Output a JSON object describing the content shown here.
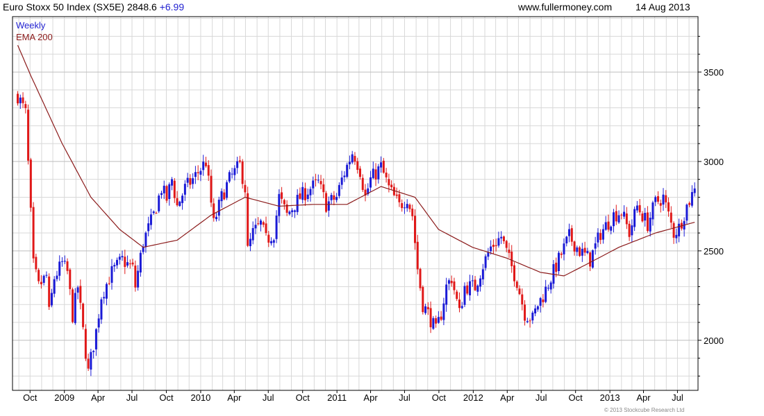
{
  "header": {
    "title": "Euro Stoxx 50 Index (SX5E) 2848.6",
    "change": "+6.99",
    "website": "www.fullermoney.com",
    "date": "14 Aug 2013"
  },
  "copyright": "© 2013 Stockcube Research Ltd",
  "colors": {
    "up": "#1a1ad6",
    "down": "#e01818",
    "ema": "#8b1a1a",
    "grid": "#d8d8d8",
    "legend_weekly": "#1f1fd0",
    "legend_ema": "#8b1a1a"
  },
  "chart_data": {
    "type": "candlestick",
    "legend": [
      "Weekly",
      "EMA 200"
    ],
    "legend_placement": "top-left",
    "y_axis_position": "right",
    "ylim": [
      1720,
      3810
    ],
    "yticks": [
      2000,
      2500,
      3000,
      3500
    ],
    "grid": true,
    "x_tick_labels": [
      "Oct",
      "2009",
      "Apr",
      "Jul",
      "Oct",
      "2010",
      "Apr",
      "Jul",
      "Oct",
      "2011",
      "Apr",
      "Jul",
      "Oct",
      "2012",
      "Apr",
      "Jul",
      "Oct",
      "2013",
      "Apr",
      "Jul"
    ],
    "weekly_close_path": [
      [
        "2008-08-29",
        3370
      ],
      [
        "2008-09-19",
        3270
      ],
      [
        "2008-10-10",
        2420
      ],
      [
        "2008-10-24",
        2300
      ],
      [
        "2008-11-14",
        2360
      ],
      [
        "2008-11-21",
        2150
      ],
      [
        "2008-12-05",
        2350
      ],
      [
        "2008-12-26",
        2430
      ],
      [
        "2009-01-09",
        2380
      ],
      [
        "2009-01-23",
        2140
      ],
      [
        "2009-02-06",
        2300
      ],
      [
        "2009-02-20",
        2050
      ],
      [
        "2009-03-06",
        1820
      ],
      [
        "2009-03-13",
        1900
      ],
      [
        "2009-03-27",
        2050
      ],
      [
        "2009-04-10",
        2250
      ],
      [
        "2009-05-08",
        2380
      ],
      [
        "2009-06-05",
        2450
      ],
      [
        "2009-07-03",
        2400
      ],
      [
        "2009-07-10",
        2300
      ],
      [
        "2009-07-31",
        2550
      ],
      [
        "2009-08-28",
        2700
      ],
      [
        "2009-09-18",
        2850
      ],
      [
        "2009-10-02",
        2790
      ],
      [
        "2009-10-16",
        2900
      ],
      [
        "2009-10-30",
        2750
      ],
      [
        "2009-11-20",
        2850
      ],
      [
        "2009-12-11",
        2900
      ],
      [
        "2010-01-01",
        2960
      ],
      [
        "2010-01-15",
        3000
      ],
      [
        "2010-02-05",
        2650
      ],
      [
        "2010-02-26",
        2800
      ],
      [
        "2010-03-19",
        2900
      ],
      [
        "2010-04-16",
        2980
      ],
      [
        "2010-04-30",
        2850
      ],
      [
        "2010-05-07",
        2500
      ],
      [
        "2010-05-21",
        2600
      ],
      [
        "2010-06-11",
        2650
      ],
      [
        "2010-06-25",
        2560
      ],
      [
        "2010-07-16",
        2600
      ],
      [
        "2010-07-30",
        2800
      ],
      [
        "2010-08-20",
        2700
      ],
      [
        "2010-09-10",
        2760
      ],
      [
        "2010-09-24",
        2800
      ],
      [
        "2010-10-22",
        2850
      ],
      [
        "2010-11-12",
        2880
      ],
      [
        "2010-12-03",
        2760
      ],
      [
        "2010-12-31",
        2800
      ],
      [
        "2011-01-14",
        2900
      ],
      [
        "2011-02-11",
        3050
      ],
      [
        "2011-02-18",
        3030
      ],
      [
        "2011-03-04",
        2950
      ],
      [
        "2011-03-18",
        2800
      ],
      [
        "2011-04-01",
        2900
      ],
      [
        "2011-04-29",
        2970
      ],
      [
        "2011-05-20",
        2850
      ],
      [
        "2011-06-17",
        2750
      ],
      [
        "2011-07-08",
        2800
      ],
      [
        "2011-07-22",
        2700
      ],
      [
        "2011-08-05",
        2400
      ],
      [
        "2011-08-19",
        2200
      ],
      [
        "2011-09-02",
        2150
      ],
      [
        "2011-09-23",
        2050
      ],
      [
        "2011-10-07",
        2150
      ],
      [
        "2011-10-21",
        2300
      ],
      [
        "2011-11-04",
        2350
      ],
      [
        "2011-11-25",
        2150
      ],
      [
        "2011-12-09",
        2300
      ],
      [
        "2012-01-06",
        2300
      ],
      [
        "2012-01-27",
        2420
      ],
      [
        "2012-02-17",
        2520
      ],
      [
        "2012-03-16",
        2580
      ],
      [
        "2012-04-06",
        2450
      ],
      [
        "2012-04-27",
        2330
      ],
      [
        "2012-05-18",
        2150
      ],
      [
        "2012-06-08",
        2120
      ],
      [
        "2012-06-22",
        2200
      ],
      [
        "2012-07-06",
        2250
      ],
      [
        "2012-07-27",
        2350
      ],
      [
        "2012-08-17",
        2450
      ],
      [
        "2012-09-14",
        2580
      ],
      [
        "2012-10-12",
        2500
      ],
      [
        "2012-11-09",
        2450
      ],
      [
        "2012-12-07",
        2600
      ],
      [
        "2013-01-11",
        2700
      ],
      [
        "2013-02-01",
        2720
      ],
      [
        "2013-02-22",
        2600
      ],
      [
        "2013-03-15",
        2750
      ],
      [
        "2013-04-12",
        2650
      ],
      [
        "2013-05-03",
        2770
      ],
      [
        "2013-05-24",
        2800
      ],
      [
        "2013-06-07",
        2700
      ],
      [
        "2013-06-21",
        2600
      ],
      [
        "2013-07-05",
        2630
      ],
      [
        "2013-07-26",
        2750
      ],
      [
        "2013-08-16",
        2849
      ]
    ],
    "ema200_path": [
      [
        "2008-08-29",
        3650
      ],
      [
        "2008-10-03",
        3480
      ],
      [
        "2008-12-26",
        3100
      ],
      [
        "2009-03-13",
        2800
      ],
      [
        "2009-05-29",
        2620
      ],
      [
        "2009-07-31",
        2520
      ],
      [
        "2009-10-30",
        2560
      ],
      [
        "2010-01-29",
        2700
      ],
      [
        "2010-04-30",
        2800
      ],
      [
        "2010-07-30",
        2750
      ],
      [
        "2010-10-29",
        2760
      ],
      [
        "2011-01-28",
        2760
      ],
      [
        "2011-04-29",
        2860
      ],
      [
        "2011-07-29",
        2800
      ],
      [
        "2011-09-30",
        2620
      ],
      [
        "2011-12-30",
        2520
      ],
      [
        "2012-03-30",
        2460
      ],
      [
        "2012-06-29",
        2380
      ],
      [
        "2012-08-31",
        2360
      ],
      [
        "2012-10-26",
        2420
      ],
      [
        "2013-01-25",
        2520
      ],
      [
        "2013-05-03",
        2600
      ],
      [
        "2013-08-16",
        2660
      ]
    ]
  }
}
